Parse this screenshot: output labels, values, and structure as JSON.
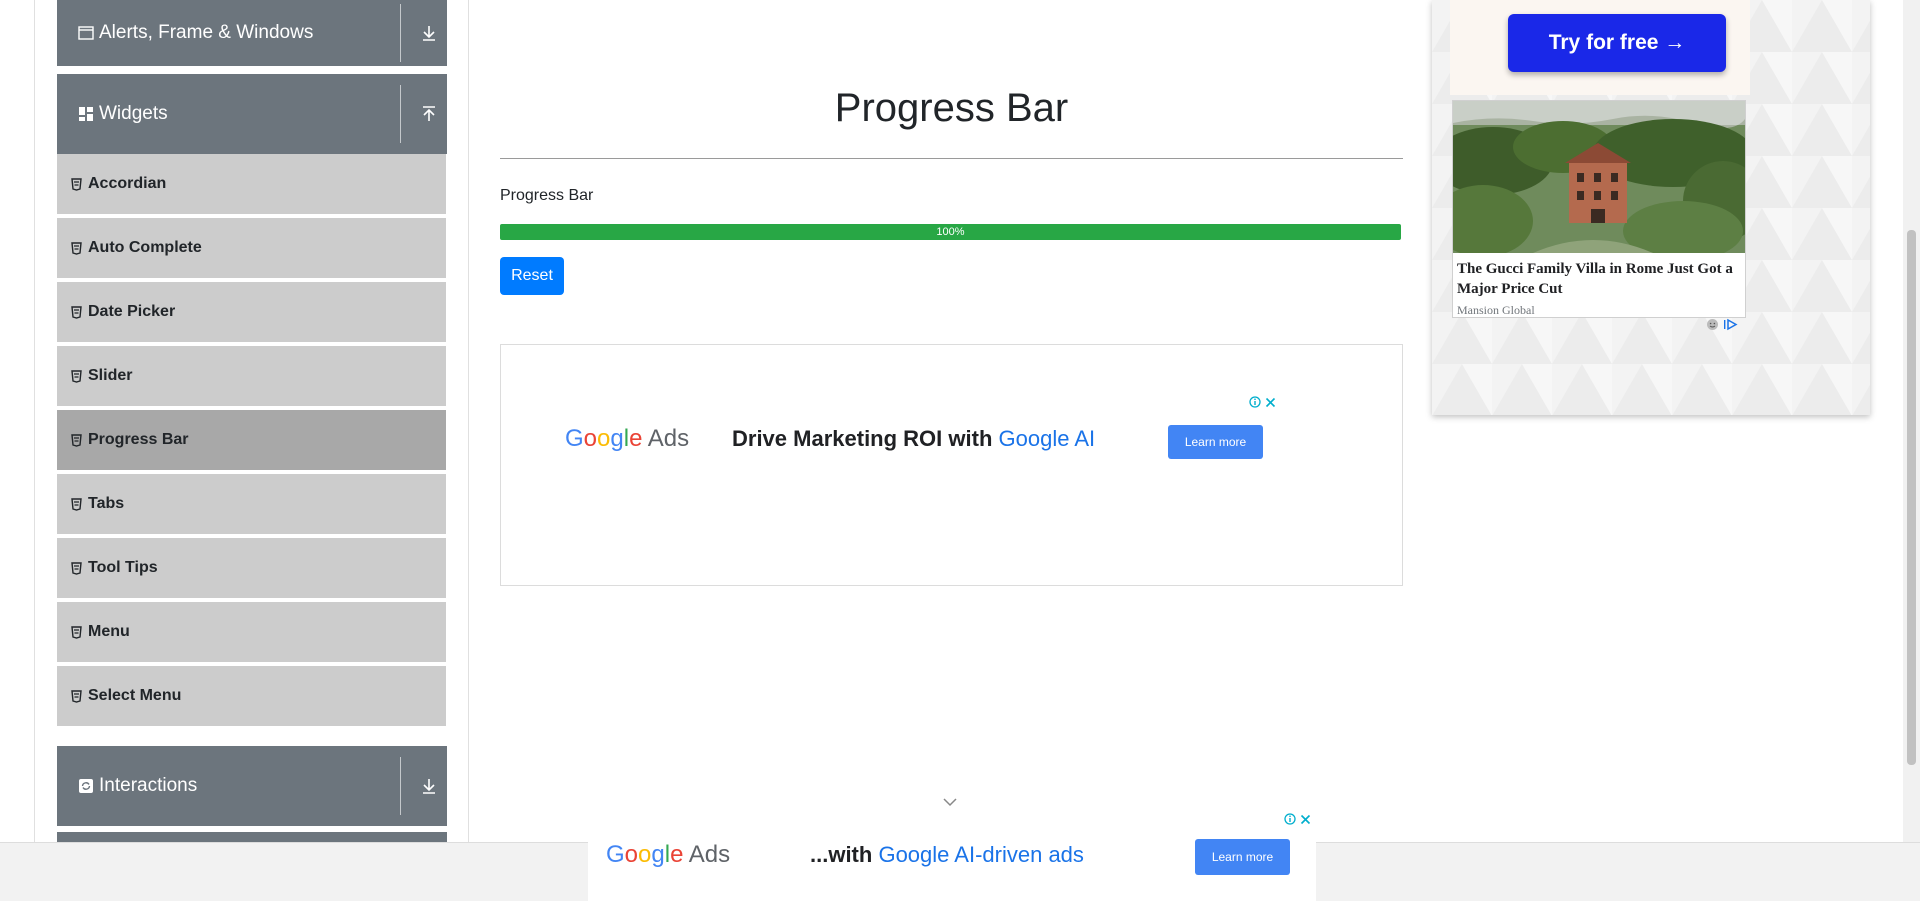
{
  "sidebar": {
    "groups": {
      "alerts": {
        "label": "Alerts, Frame & Windows",
        "icon": "window-icon",
        "arrow": "download-arrow-icon"
      },
      "widgets": {
        "label": "Widgets",
        "icon": "grid-icon",
        "arrow": "upload-arrow-icon"
      },
      "interactions": {
        "label": "Interactions",
        "icon": "refresh-box-icon",
        "arrow": "download-arrow-icon"
      }
    },
    "items": [
      {
        "label": "Accordian"
      },
      {
        "label": "Auto Complete"
      },
      {
        "label": "Date Picker"
      },
      {
        "label": "Slider"
      },
      {
        "label": "Progress Bar",
        "active": true
      },
      {
        "label": "Tabs"
      },
      {
        "label": "Tool Tips"
      },
      {
        "label": "Menu"
      },
      {
        "label": "Select Menu"
      }
    ]
  },
  "main": {
    "title": "Progress Bar",
    "progress_label": "Progress Bar",
    "progress_text": "100%",
    "progress_value": 100,
    "reset_label": "Reset"
  },
  "ads": {
    "inline": {
      "logo_g1": "G",
      "logo_o1": "o",
      "logo_o2": "o",
      "logo_g2": "g",
      "logo_l": "l",
      "logo_e": "e",
      "logo_ads": "Ads",
      "headline_lead": "Drive Marketing ROI with ",
      "headline_highlight": "Google AI",
      "cta": "Learn more"
    },
    "side": {
      "try_label": "Try for free →",
      "card_title": "The Gucci Family Villa in Rome Just Got a Major Price Cut",
      "card_source": "Mansion Global"
    },
    "bottom": {
      "logo_g1": "G",
      "logo_o1": "o",
      "logo_o2": "o",
      "logo_g2": "g",
      "logo_l": "l",
      "logo_e": "e",
      "logo_ads": "Ads",
      "headline_lead": "...with ",
      "headline_highlight": "Google AI-driven ads",
      "cta": "Learn more"
    }
  },
  "colors": {
    "sidebar_header": "#6c757d",
    "menu_item": "#cccccc",
    "menu_item_active": "#a8a8a8",
    "progress_fill": "#28a745",
    "primary": "#007bff",
    "try_button": "#1a28e8"
  }
}
